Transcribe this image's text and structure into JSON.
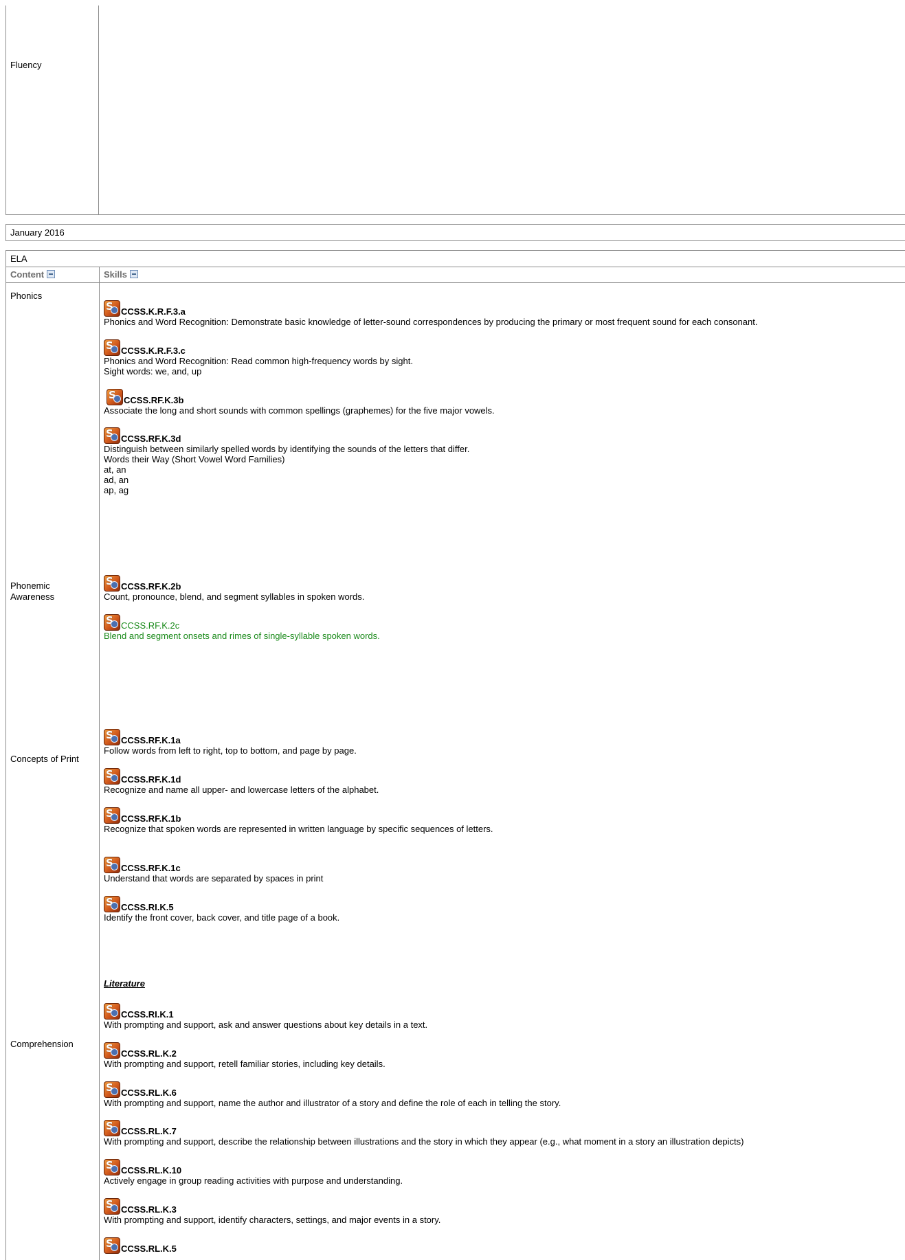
{
  "fluency_block": {
    "label": "Fluency"
  },
  "month_bar": {
    "label": "January 2016"
  },
  "ela": {
    "subject": "ELA",
    "headers": {
      "content": "Content",
      "skills": "Skills"
    },
    "content_labels": {
      "phonics": "Phonics",
      "phonemic": "Phonemic\nAwareness",
      "concepts": "Concepts of Print",
      "comprehension": "Comprehension"
    },
    "phonics_skills": [
      {
        "code": "CCSS.K.R.F.3.a",
        "desc": "Phonics and Word Recognition: Demonstrate basic knowledge of letter-sound correspondences by producing the primary or most frequent sound for each consonant."
      },
      {
        "code": "CCSS.K.R.F.3.c",
        "desc": "Phonics and Word Recognition: Read common high-frequency words by sight.\nSight words: we, and, up"
      },
      {
        "code": "CCSS.RF.K.3b",
        "desc": "Associate the long and short sounds with common spellings (graphemes) for the five major vowels."
      },
      {
        "code": "CCSS.RF.K.3d",
        "desc": "Distinguish between similarly spelled words by identifying the sounds of the letters that differ.\nWords their Way (Short Vowel Word Families)\n at, an\nad, an\nap, ag"
      }
    ],
    "phonemic_skills": [
      {
        "code": "CCSS.RF.K.2b",
        "desc": "Count, pronounce, blend, and segment syllables in spoken words."
      },
      {
        "code": "CCSS.RF.K.2c",
        "desc": "Blend and segment onsets and rimes of single-syllable spoken words."
      }
    ],
    "concepts_skills": [
      {
        "code": "CCSS.RF.K.1a",
        "desc": "Follow words from left to right, top to bottom, and page by page."
      },
      {
        "code": "CCSS.RF.K.1d",
        "desc": "Recognize and name all upper- and lowercase letters of the alphabet."
      },
      {
        "code": "CCSS.RF.K.1b",
        "desc": " Recognize that spoken words are represented in written language by specific sequences of letters."
      },
      {
        "code": "CCSS.RF.K.1c",
        "desc": "Understand that words are separated by spaces in print"
      },
      {
        "code": "CCSS.RI.K.5",
        "desc": "Identify the front cover, back cover, and title page of a book."
      }
    ],
    "comprehension": {
      "section_title": "Literature",
      "skills": [
        {
          "code": "CCSS.RI.K.1",
          "desc": "With prompting and support, ask and answer questions about key details in a text."
        },
        {
          "code": "CCSS.RL.K.2",
          "desc": "With prompting and support, retell familiar stories, including key details."
        },
        {
          "code": "CCSS.RL.K.6",
          "desc": "With prompting and support, name the author and illustrator of a story and define the role of each in telling the story."
        },
        {
          "code": "CCSS.RL.K.7",
          "desc": "With prompting and support, describe the relationship between illustrations and the story in which they appear (e.g., what moment in a story an illustration depicts)"
        },
        {
          "code": "CCSS.RL.K.10",
          "desc": "Actively engage in group reading activities with purpose and understanding."
        },
        {
          "code": "CCSS.RL.K.3",
          "desc": "With prompting and support, identify characters, settings, and major events in a story."
        },
        {
          "code": "CCSS.RL.K.5",
          "desc": ""
        }
      ]
    }
  }
}
